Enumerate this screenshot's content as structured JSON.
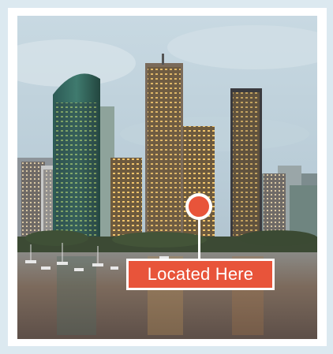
{
  "marker": {
    "label": "Located Here",
    "color": "#e8543a",
    "outline_color": "#ffffff"
  },
  "photo": {
    "subject": "city-skyline-river"
  },
  "colors": {
    "background": "#dce9f0",
    "frame": "#ffffff"
  }
}
